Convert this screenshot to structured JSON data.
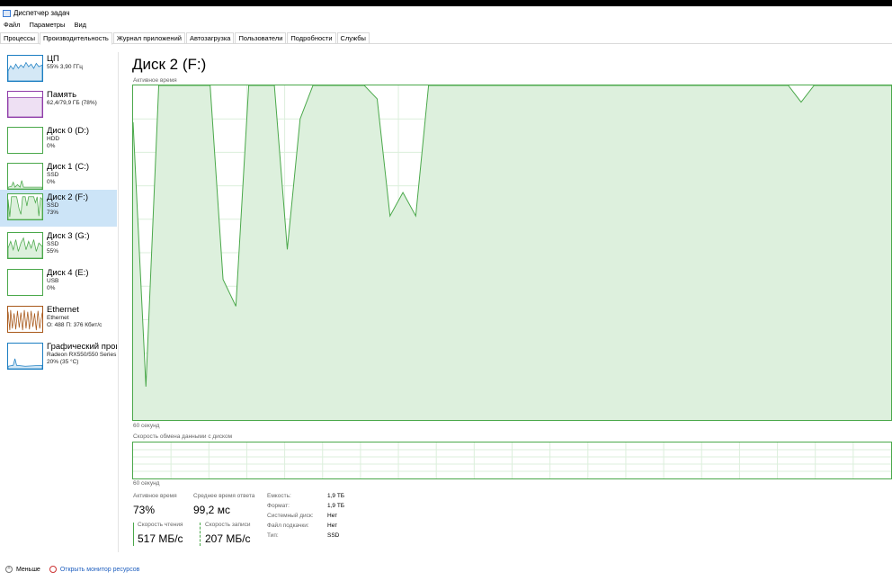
{
  "window": {
    "title": "Диспетчер задач"
  },
  "menu": [
    "Файл",
    "Параметры",
    "Вид"
  ],
  "tabs": [
    "Процессы",
    "Производительность",
    "Журнал приложений",
    "Автозагрузка",
    "Пользователи",
    "Подробности",
    "Службы"
  ],
  "active_tab": "Производительность",
  "sidebar": [
    {
      "name": "ЦП",
      "line1": "55% 3,90 ГГц",
      "line2": "",
      "color": "#1b7ec2"
    },
    {
      "name": "Память",
      "line1": "62,4/79,9 ГБ (78%)",
      "line2": "",
      "color": "#8e3aa8"
    },
    {
      "name": "Диск 0 (D:)",
      "line1": "HDD",
      "line2": "0%",
      "color": "#4aa84a"
    },
    {
      "name": "Диск 1 (C:)",
      "line1": "SSD",
      "line2": "0%",
      "color": "#4aa84a"
    },
    {
      "name": "Диск 2 (F:)",
      "line1": "SSD",
      "line2": "73%",
      "color": "#4aa84a"
    },
    {
      "name": "Диск 3 (G:)",
      "line1": "SSD",
      "line2": "55%",
      "color": "#4aa84a"
    },
    {
      "name": "Диск 4 (E:)",
      "line1": "USB",
      "line2": "0%",
      "color": "#4aa84a"
    },
    {
      "name": "Ethernet",
      "line1": "Ethernet",
      "line2": "О: 488 П: 376 Кбит/с",
      "color": "#a8581a"
    },
    {
      "name": "Графический проц",
      "line1": "Radeon RX550/550 Series",
      "line2": "20% (35 °C)",
      "color": "#1b7ec2"
    }
  ],
  "selected_index": 4,
  "main": {
    "title": "Диск 2 (F:)",
    "graph1_label": "Активное время",
    "graph1_footer": "60 секунд",
    "graph2_label": "Скорость обмена данными с диском",
    "graph2_footer": "60 секунд"
  },
  "activity_series": [
    89,
    10,
    100,
    100,
    100,
    100,
    100,
    42,
    34,
    100,
    100,
    100,
    51,
    90,
    100,
    100,
    100,
    100,
    100,
    96,
    61,
    68,
    61,
    100,
    100,
    100,
    100,
    100,
    100,
    100,
    100,
    100,
    100,
    100,
    100,
    100,
    100,
    100,
    100,
    100,
    100,
    100,
    100,
    100,
    100,
    100,
    100,
    100,
    100,
    100,
    100,
    100,
    95,
    100,
    100,
    100,
    100,
    100,
    100,
    100,
    100,
    100,
    100,
    100,
    100,
    100,
    100,
    100,
    100,
    100,
    100,
    100,
    100,
    100,
    100,
    100,
    100,
    100,
    100,
    100,
    100,
    100,
    100,
    100,
    100,
    100,
    100,
    100,
    100,
    100,
    100,
    100,
    100,
    100,
    100,
    100,
    100,
    100,
    100,
    100
  ],
  "stats": {
    "active_time_label": "Активное время",
    "active_time_value": "73%",
    "avg_response_label": "Среднее время ответа",
    "avg_response_value": "99,2 мс",
    "read_label": "Скорость чтения",
    "read_value": "517 МБ/с",
    "write_label": "Скорость записи",
    "write_value": "207 МБ/с"
  },
  "properties": [
    {
      "label": "Емкость:",
      "value": "1,9 ТБ"
    },
    {
      "label": "Формат:",
      "value": "1,9 ТБ"
    },
    {
      "label": "Системный диск:",
      "value": "Нет"
    },
    {
      "label": "Файл подкачки:",
      "value": "Нет"
    },
    {
      "label": "Тип:",
      "value": "SSD"
    }
  ],
  "footer": {
    "less": "Меньше",
    "monitor": "Открыть монитор ресурсов"
  }
}
